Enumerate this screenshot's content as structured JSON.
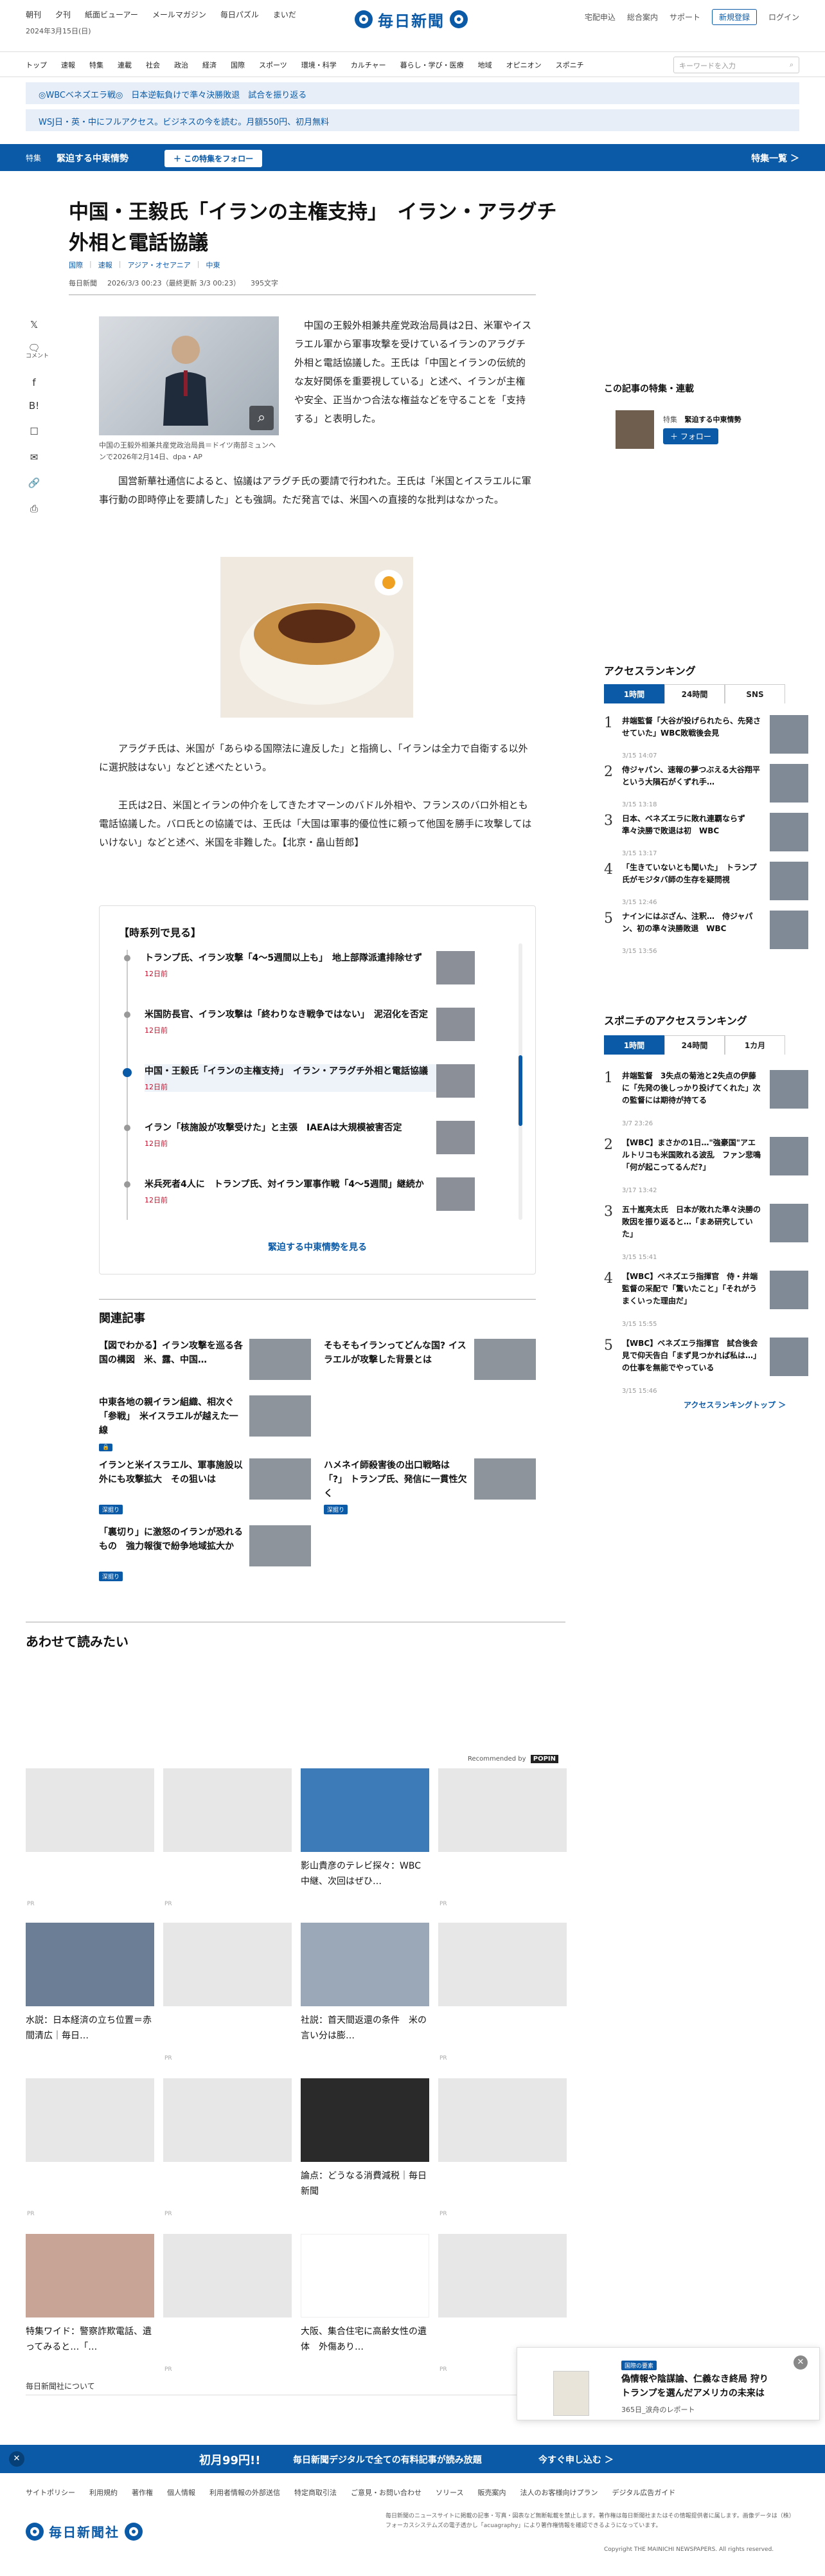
{
  "utility": {
    "left_links": [
      "朝刊",
      "夕刊",
      "紙面ビューアー",
      "メールマガジン",
      "毎日パズル",
      "まいだ"
    ],
    "date": "2024年3月15日(日)",
    "logo_text": "毎日新聞",
    "right_links": [
      "宅配申込",
      "総合案内",
      "サポート"
    ],
    "signup": "新規登録",
    "login": "ログイン"
  },
  "gnav": {
    "items": [
      "トップ",
      "速報",
      "特集",
      "連載",
      "社会",
      "政治",
      "経済",
      "国際",
      "スポーツ",
      "環境・科学",
      "カルチャー",
      "暮らし・学び・医療",
      "地域",
      "オピニオン",
      "スポニチ"
    ],
    "search_placeholder": "キーワードを入力",
    "search_icon": "search-icon"
  },
  "banners": [
    "◎WBCベネズエラ戦◎　日本逆転負けで準々決勝敗退　試合を振り返る",
    "WSJ日・英・中にフルアクセス。ビジネスの今を読む。月額550円、初月無料"
  ],
  "feature_bar": {
    "tag": "特集",
    "title": "緊迫する中東情勢",
    "follow": "＋ この特集をフォロー",
    "list": "特集一覧 ＞"
  },
  "article": {
    "title": "中国・王毅氏「イランの主権支持」　イラン・アラグチ外相と電話協議",
    "categories": [
      "国際",
      "速報",
      "アジア・オセアニア",
      "中東"
    ],
    "source": "毎日新聞",
    "published": "2026/3/3 00:23（最終更新 3/3 00:23）",
    "chars": "395文字",
    "share_label": "コメント",
    "caption": "中国の王毅外相兼共産党政治局員＝ドイツ南部ミュンヘンで2026年2月14日、dpa・AP",
    "para1": "中国の王毅外相兼共産党政治局員は2日、米軍やイスラエル軍から軍事攻撃を受けているイランのアラグチ外相と電話協議した。王氏は「中国とイランの伝統的な友好関係を重要視している」と述べ、イランが主権や安全、正当かつ合法な権益などを守ることを「支持する」と表明した。",
    "para2": "国営新華社通信によると、協議はアラグチ氏の要請で行われた。王氏は「米国とイスラエルに軍事行動の即時停止を要請した」とも強調。ただ発言では、米国への直接的な批判はなかった。",
    "para3": "アラグチ氏は、米国が「あらゆる国際法に違反した」と指摘し、「イランは全力で自衛する以外に選択肢はない」などと述べたという。",
    "para4": "王氏は2日、米国とイランの仲介をしてきたオマーンのバドル外相や、フランスのバロ外相とも電話協議した。バロ氏との協議では、王氏は「大国は軍事的優位性に頼って他国を勝手に攻撃してはいけない」などと述べ、米国を非難した。【北京・畠山哲郎】"
  },
  "timeline": {
    "title": "【時系列で見る】",
    "items": [
      {
        "head": "トランプ氏、イラン攻撃「4～5週間以上も」　地上部隊派遣排除せず",
        "date": "12日前"
      },
      {
        "head": "米国防長官、イラン攻撃は「終わりなき戦争ではない」　泥沼化を否定",
        "date": "12日前"
      },
      {
        "head": "中国・王毅氏「イランの主権支持」　イラン・アラグチ外相と電話協議",
        "date": "12日前"
      },
      {
        "head": "イラン「核施設が攻撃受けた」と主張　IAEAは大規模被害否定",
        "date": "12日前"
      },
      {
        "head": "米兵死者4人に　トランプ氏、対イラン軍事作戦「4～5週間」継続か",
        "date": "12日前"
      }
    ],
    "more": "緊迫する中東情勢を見る"
  },
  "related": {
    "title": "関連記事",
    "items": [
      {
        "text": "【図でわかる】イラン攻撃を巡る各国の構図　米、露、中国…",
        "badge": ""
      },
      {
        "text": "そもそもイランってどんな国? イスラエルが攻撃した背景とは",
        "badge": ""
      },
      {
        "text": "中東各地の親イラン組織、相次ぐ「参戦」　米イスラエルが越えた一線",
        "badge": "🔒"
      },
      {
        "text": "",
        "badge": ""
      },
      {
        "text": "イランと米イスラエル、軍事施設以外にも攻撃拡大　その狙いは",
        "badge": "深掘り"
      },
      {
        "text": "ハメネイ師殺害後の出口戦略は「?」 トランプ氏、発信に一貫性欠く",
        "badge": "深掘り"
      },
      {
        "text": "「裏切り」に激怒のイランが恐れるもの　強力報復で紛争地域拡大か",
        "badge": "深掘り"
      }
    ]
  },
  "sidebar": {
    "feature_title": "この記事の特集・連載",
    "feature_tag": "特集",
    "feature_name": "緊迫する中東情勢",
    "feature_follow": "＋ フォロー",
    "access_title": "アクセスランキング",
    "access_tabs": [
      "1時間",
      "24時間",
      "SNS"
    ],
    "access_items": [
      {
        "no": "1",
        "text": "井端監督「大谷が投げられたら、先発させていた」WBC敗戦後会見",
        "date": "3/15 14:07"
      },
      {
        "no": "2",
        "text": "侍ジャパン、速報の夢つぶえる大谷翔平という大隕石がくずれ手…",
        "date": "3/15 13:18"
      },
      {
        "no": "3",
        "text": "日本、ベネズエラに敗れ連覇ならず　準々決勝で敗退は初　WBC",
        "date": "3/15 13:17"
      },
      {
        "no": "4",
        "text": "「生きていないとも聞いた」　トランプ氏がモジタバ師の生存を疑問視",
        "date": "3/15 12:46"
      },
      {
        "no": "5",
        "text": "ナインにはぶざん、注釈…　侍ジャパン、初の準々決勝敗退　WBC",
        "date": "3/15 13:56"
      }
    ],
    "sponichi_title": "スポニチのアクセスランキング",
    "sponichi_tabs": [
      "1時間",
      "24時間",
      "1カ月"
    ],
    "sponichi_items": [
      {
        "no": "1",
        "text": "井端監督　3失点の菊池と2失点の伊藤に「先発の後しっかり投げてくれた」次の監督には期待が持てる",
        "date": "3/7 23:26"
      },
      {
        "no": "2",
        "text": "【WBC】まさかの1日…\"強豪国\"アエルトリコも米国敗れる波乱　ファン悲鳴「何が起こってるんだ?」",
        "date": "3/17 13:42"
      },
      {
        "no": "3",
        "text": "五十嵐亮太氏　日本が敗れた準々決勝の敗因を振り返ると…「まあ研究していた」",
        "date": "3/15 15:41"
      },
      {
        "no": "4",
        "text": "【WBC】ベネズエラ指揮官　侍・井端監督の采配で「驚いたこと」「それがうまくいった理由だ」",
        "date": "3/15 15:55"
      },
      {
        "no": "5",
        "text": "【WBC】ベネズエラ指揮官　試合後会見で仰天告白「まず見つかれば私は…」の仕事を無能でやっている",
        "date": "3/15 15:46"
      }
    ],
    "ranking_more": "アクセスランキングトップ ＞"
  },
  "recommend": {
    "title": "あわせて読みたい",
    "powered": "Recommended by",
    "powered_brand": "POPIN",
    "pr": "PR",
    "cards": [
      {
        "text": ""
      },
      {
        "text": ""
      },
      {
        "text": "影山貴彦のテレビ探々：WBC中継、次回はぜひ…"
      },
      {
        "text": ""
      },
      {
        "text": "水説：日本経済の立ち位置＝赤間清広｜毎日…"
      },
      {
        "text": ""
      },
      {
        "text": "社説：首天間返還の条件　米の言い分は膨…"
      },
      {
        "text": ""
      },
      {
        "text": ""
      },
      {
        "text": ""
      },
      {
        "text": "論点：どうなる消費減税｜毎日新聞"
      },
      {
        "text": ""
      },
      {
        "text": "特集ワイド：警察詐欺電話、遺ってみると…「…"
      },
      {
        "text": ""
      },
      {
        "text": "大阪、集合住宅に高齢女性の遺体　外傷あり…"
      },
      {
        "text": ""
      }
    ]
  },
  "popup": {
    "badge": "国際の要素",
    "text": "偽情報や陰謀論、仁義なき終局 狩りトランプを選んだアメリカの未来は",
    "sub": "365日_涙舟のレポート"
  },
  "bottom_bar": {
    "price": "初月99円!!",
    "text": "毎日新聞デジタルで全ての有料記事が読み放題",
    "cta": "今すぐ申し込む ＞"
  },
  "footer": {
    "about": "毎日新聞社について",
    "links": [
      "サイトポリシー",
      "利用規約",
      "著作権",
      "個人情報",
      "利用者情報の外部送信",
      "特定商取引法",
      "ご意見・お問い合わせ",
      "ソリース",
      "販売案内",
      "法人のお客様向けプラン",
      "デジタル広告ガイド"
    ],
    "company": "毎日新聞社",
    "note": "毎日新聞のニュースサイトに掲載の記事・写真・図表など無断転載を禁止します。著作権は毎日新聞社またはその情報提供者に属します。画像データは（株）フォーカスシステムズの電子透かし「acuagraphy」により著作権情報を確認できるようになっています。",
    "copyright": "Copyright THE MAINICHI NEWSPAPERS. All rights reserved."
  },
  "colors": {
    "brand": "#0a5aa8",
    "date_red": "#c8102e",
    "banner_bg": "#e7eef7"
  }
}
